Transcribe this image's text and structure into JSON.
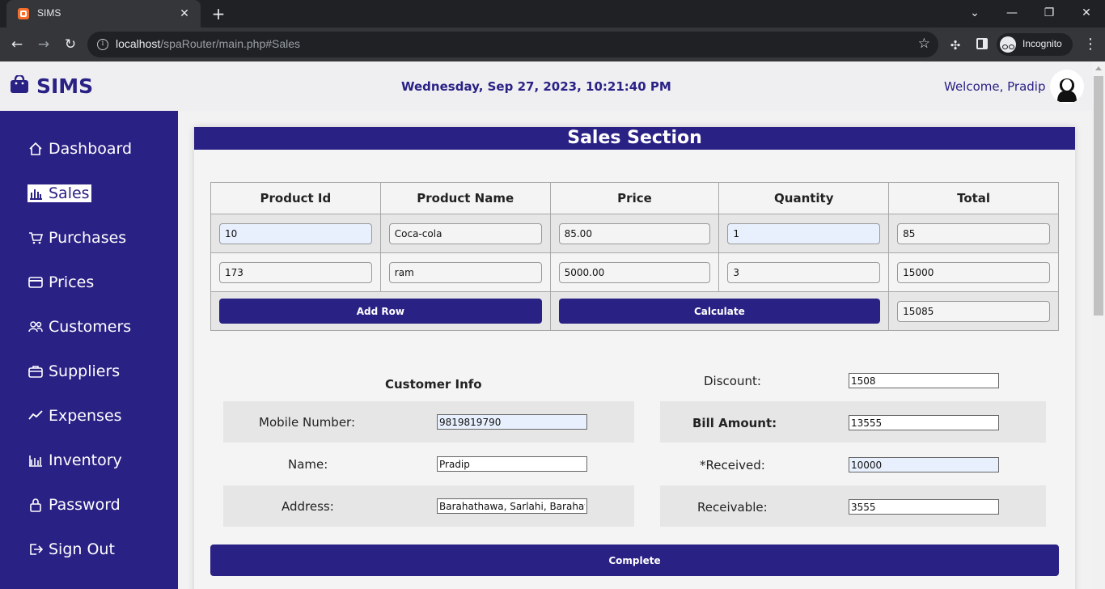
{
  "browser": {
    "tab_title": "SIMS",
    "tab_close": "✕",
    "new_tab": "+",
    "url_host": "localhost",
    "url_path": "/spaRouter/main.php#Sales",
    "profile_label": "Incognito",
    "window_controls": [
      "⌄",
      "—",
      "❐",
      "✕"
    ]
  },
  "header": {
    "brand": "SIMS",
    "datetime": "Wednesday, Sep 27, 2023, 10:21:40 PM",
    "welcome": "Welcome, Pradip"
  },
  "sidebar": {
    "items": [
      {
        "label": "Dashboard",
        "icon": "home-icon"
      },
      {
        "label": "Sales",
        "icon": "bar-chart-icon",
        "active": true
      },
      {
        "label": "Purchases",
        "icon": "cart-icon"
      },
      {
        "label": "Prices",
        "icon": "card-icon"
      },
      {
        "label": "Customers",
        "icon": "users-icon"
      },
      {
        "label": "Suppliers",
        "icon": "briefcase-icon"
      },
      {
        "label": "Expenses",
        "icon": "trend-icon"
      },
      {
        "label": "Inventory",
        "icon": "inventory-icon"
      },
      {
        "label": "Password",
        "icon": "lock-icon"
      },
      {
        "label": "Sign Out",
        "icon": "sign-out-icon"
      }
    ]
  },
  "sales": {
    "title": "Sales Section",
    "columns": [
      "Product Id",
      "Product Name",
      "Price",
      "Quantity",
      "Total"
    ],
    "rows": [
      {
        "product_id": "10",
        "product_name": "Coca-cola",
        "price": "85.00",
        "quantity": "1",
        "total": "85"
      },
      {
        "product_id": "173",
        "product_name": "ram",
        "price": "5000.00",
        "quantity": "3",
        "total": "15000"
      }
    ],
    "add_row_label": "Add Row",
    "calculate_label": "Calculate",
    "grand_total": "15085"
  },
  "customer": {
    "title": "Customer Info",
    "mobile_label": "Mobile Number:",
    "mobile_value": "9819819790",
    "name_label": "Name:",
    "name_value": "Pradip",
    "address_label": "Address:",
    "address_value": "Barahathawa, Sarlahi, Barahathawa"
  },
  "billing": {
    "discount_label": "Discount:",
    "discount_value": "1508",
    "bill_amount_label": "Bill Amount:",
    "bill_amount_value": "13555",
    "received_label": "*Received:",
    "received_value": "10000",
    "receivable_label": "Receivable:",
    "receivable_value": "3555"
  },
  "complete_label": "Complete",
  "colors": {
    "brand": "#2a2185",
    "chrome_dark": "#202124",
    "chrome_toolbar": "#35363a"
  }
}
